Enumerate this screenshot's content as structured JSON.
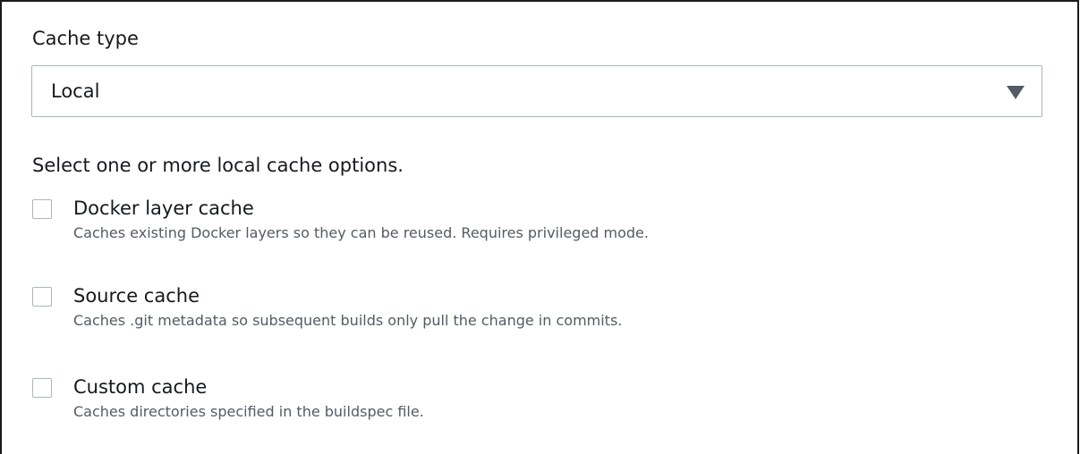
{
  "cache_type": {
    "label": "Cache type",
    "selected": "Local",
    "caret_icon": "caret-down-icon"
  },
  "local_cache": {
    "helper": "Select one or more local cache options.",
    "options": [
      {
        "title": "Docker layer cache",
        "description": "Caches existing Docker layers so they can be reused. Requires privileged mode.",
        "checked": false
      },
      {
        "title": "Source cache",
        "description": "Caches .git metadata so subsequent builds only pull the change in commits.",
        "checked": false
      },
      {
        "title": "Custom cache",
        "description": "Caches directories specified in the buildspec file.",
        "checked": false
      }
    ]
  },
  "colors": {
    "text": "#16191f",
    "secondary_text": "#545b64",
    "border": "#aab7b8",
    "caret": "#545b64"
  }
}
